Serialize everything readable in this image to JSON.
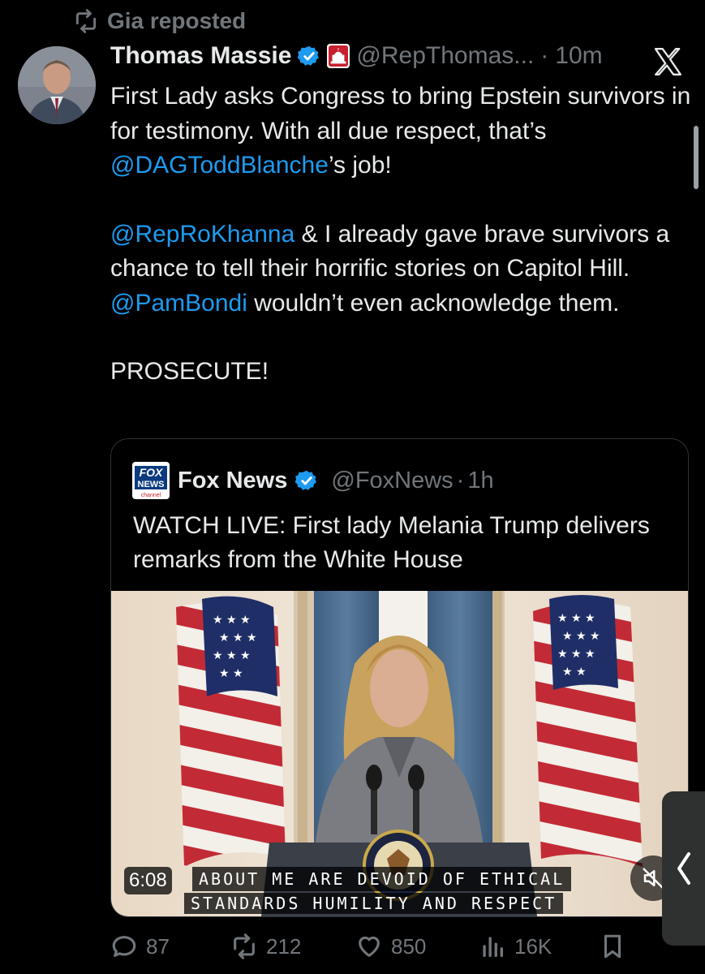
{
  "repost": {
    "label": "Gia reposted",
    "icon": "repost-icon"
  },
  "author": {
    "name": "Thomas Massie",
    "verified_icon": "verified-badge-icon",
    "affiliation_icon": "capitol-icon",
    "handle": "@RepThomas...",
    "separator": "·",
    "time": "10m",
    "platform_icon": "x-logo-icon"
  },
  "tweet": {
    "p1_a": "First Lady asks Congress to bring Epstein survivors in for testimony. With all due respect, that’s ",
    "p1_mention": "@DAGToddBlanche",
    "p1_b": "’s job!",
    "p2_mention1": "@RepRoKhanna",
    "p2_a": " & I already gave brave survivors a chance to tell their horrific stories on Capitol Hill. ",
    "p2_mention2": "@PamBondi",
    "p2_b": " wouldn’t even acknowledge them.",
    "p3": "PROSECUTE!"
  },
  "quote": {
    "name": "Fox News",
    "logo_top": "FOX",
    "logo_mid": "NEWS",
    "logo_bottom": "channel",
    "handle": "@FoxNews",
    "separator": "·",
    "time": "1h",
    "text": "WATCH LIVE: First lady Melania Trump delivers remarks from the White House",
    "video": {
      "duration": "6:08",
      "caption_line1": "ABOUT ME ARE DEVOID OF ETHICAL",
      "caption_line2": "STANDARDS  HUMILITY AND RESPECT",
      "mute_icon": "speaker-muted-icon"
    }
  },
  "actions": {
    "replies": "87",
    "reposts": "212",
    "likes": "850",
    "views": "16K"
  },
  "colors": {
    "bg": "#000000",
    "text": "#e7e9ea",
    "muted": "#71767b",
    "link": "#1d9bf0",
    "verified": "#1d9bf0"
  }
}
